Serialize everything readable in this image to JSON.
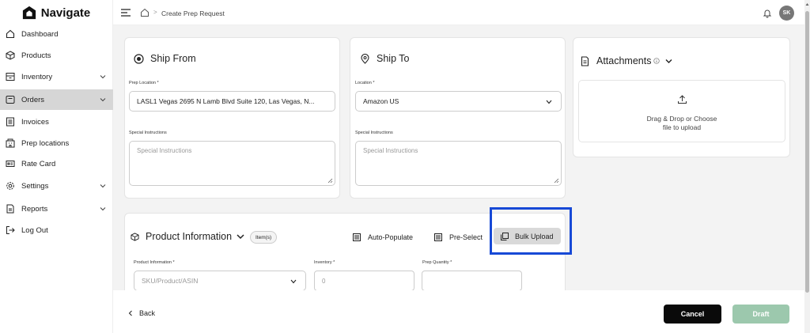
{
  "app": {
    "name": "Navigate"
  },
  "sidebar": {
    "items": [
      {
        "label": "Dashboard",
        "icon": "home-icon"
      },
      {
        "label": "Products",
        "icon": "box-icon"
      },
      {
        "label": "Inventory",
        "icon": "inventory-icon",
        "expandable": true
      },
      {
        "label": "Orders",
        "icon": "orders-icon",
        "expandable": true,
        "active": true
      },
      {
        "label": "Invoices",
        "icon": "invoice-icon"
      },
      {
        "label": "Prep locations",
        "icon": "building-icon"
      },
      {
        "label": "Rate Card",
        "icon": "card-icon"
      },
      {
        "label": "Settings",
        "icon": "gear-icon",
        "expandable": true
      },
      {
        "label": "Reports",
        "icon": "report-icon",
        "expandable": true
      },
      {
        "label": "Log Out",
        "icon": "logout-icon"
      }
    ]
  },
  "header": {
    "breadcrumb": "Create Prep Request",
    "avatar_initials": "SK"
  },
  "ship_from": {
    "title": "Ship From",
    "location_label": "Prep Location *",
    "location_value": "LASL1 Vegas 2695 N Lamb Blvd Suite 120, Las Vegas, N...",
    "instructions_label": "Special Instructions",
    "instructions_placeholder": "Special Instructions"
  },
  "ship_to": {
    "title": "Ship To",
    "location_label": "Location *",
    "location_value": "Amazon US",
    "instructions_label": "Special Instructions",
    "instructions_placeholder": "Special Instructions"
  },
  "attachments": {
    "title": "Attachments",
    "dropzone_line1": "Drag & Drop or Choose",
    "dropzone_line2": "file to upload"
  },
  "product_info": {
    "title": "Product Information",
    "badge": "Item(s)",
    "auto_populate": "Auto-Populate",
    "pre_select": "Pre-Select",
    "bulk_upload": "Bulk Upload",
    "product_label": "Product Information *",
    "product_placeholder": "SKU/Product/ASIN",
    "inventory_label": "Inventory *",
    "inventory_placeholder": "0",
    "prep_qty_label": "Prep Quantity *",
    "prep_qty_placeholder": ""
  },
  "footer": {
    "back": "Back",
    "cancel": "Cancel",
    "draft": "Draft"
  },
  "colors": {
    "active_nav": "#d6d6d6",
    "highlight": "#1749d6",
    "draft_button": "#9cc8ad",
    "cancel_button": "#0a0a0a"
  }
}
